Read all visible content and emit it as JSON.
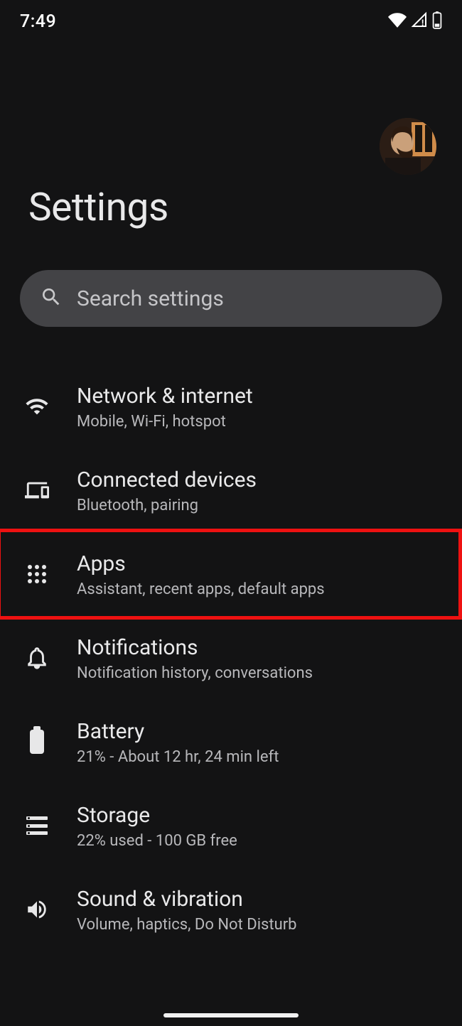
{
  "status": {
    "time": "7:49"
  },
  "header": {
    "title": "Settings"
  },
  "search": {
    "placeholder": "Search settings"
  },
  "items": [
    {
      "icon": "wifi",
      "title": "Network & internet",
      "subtitle": "Mobile, Wi-Fi, hotspot"
    },
    {
      "icon": "devices",
      "title": "Connected devices",
      "subtitle": "Bluetooth, pairing"
    },
    {
      "icon": "apps",
      "title": "Apps",
      "subtitle": "Assistant, recent apps, default apps"
    },
    {
      "icon": "bell",
      "title": "Notifications",
      "subtitle": "Notification history, conversations"
    },
    {
      "icon": "battery",
      "title": "Battery",
      "subtitle": "21% - About 12 hr, 24 min left"
    },
    {
      "icon": "storage",
      "title": "Storage",
      "subtitle": "22% used - 100 GB free"
    },
    {
      "icon": "sound",
      "title": "Sound & vibration",
      "subtitle": "Volume, haptics, Do Not Disturb"
    }
  ],
  "highlight": {
    "index": 2
  }
}
